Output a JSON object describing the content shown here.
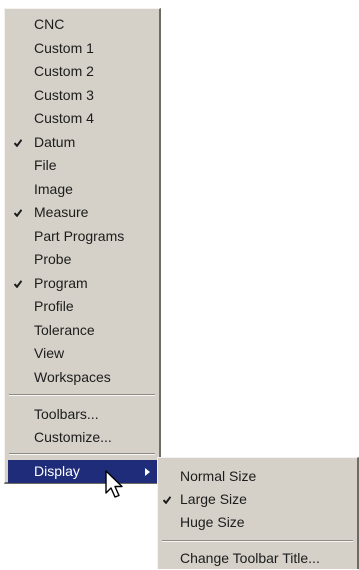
{
  "menu": {
    "items": [
      {
        "label": "CNC",
        "checked": false
      },
      {
        "label": "Custom 1",
        "checked": false
      },
      {
        "label": "Custom 2",
        "checked": false
      },
      {
        "label": "Custom 3",
        "checked": false
      },
      {
        "label": "Custom 4",
        "checked": false
      },
      {
        "label": "Datum",
        "checked": true
      },
      {
        "label": "File",
        "checked": false
      },
      {
        "label": "Image",
        "checked": false
      },
      {
        "label": "Measure",
        "checked": true
      },
      {
        "label": "Part Programs",
        "checked": false
      },
      {
        "label": "Probe",
        "checked": false
      },
      {
        "label": "Program",
        "checked": true
      },
      {
        "label": "Profile",
        "checked": false
      },
      {
        "label": "Tolerance",
        "checked": false
      },
      {
        "label": "View",
        "checked": false
      },
      {
        "label": "Workspaces",
        "checked": false
      }
    ],
    "toolbars": "Toolbars...",
    "customize": "Customize...",
    "display": "Display"
  },
  "submenu": {
    "normal_size": "Normal Size",
    "large_size": "Large Size",
    "huge_size": "Huge Size",
    "change_title": "Change Toolbar Title...",
    "checked_item": "large_size"
  },
  "colors": {
    "menu_bg": "#d5d0c8",
    "highlight": "#1e2c79",
    "text": "#1c1c1c"
  }
}
